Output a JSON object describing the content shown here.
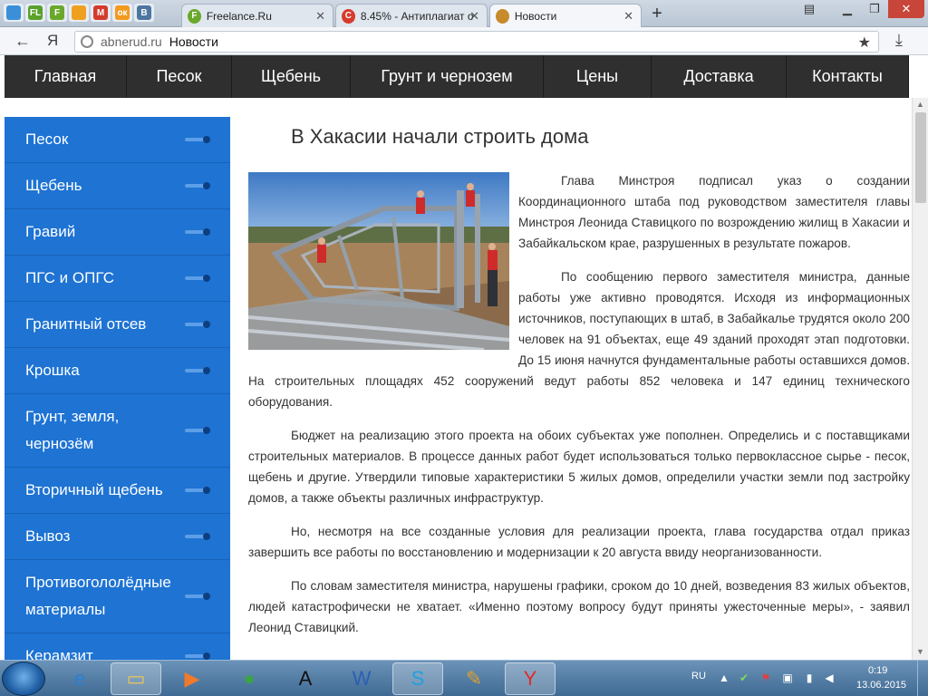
{
  "browser": {
    "pinned_tabs": [
      {
        "icon": "globe-icon",
        "label": "",
        "color": "#3a8fd8"
      },
      {
        "icon": "fl-icon",
        "label": "FL",
        "color": "#5aa12c"
      },
      {
        "icon": "freelance-f-icon",
        "label": "F",
        "color": "#6aa82c"
      },
      {
        "icon": "target-icon",
        "label": "",
        "color": "#f0a020"
      },
      {
        "icon": "gmail-icon",
        "label": "M",
        "color": "#d33b2c"
      },
      {
        "icon": "odnoklassniki-icon",
        "label": "ок",
        "color": "#f39a1d"
      },
      {
        "icon": "vk-icon",
        "label": "В",
        "color": "#4d76a1"
      }
    ],
    "tabs": [
      {
        "title": "Freelance.Ru",
        "icon": "freelance-f-icon",
        "icon_label": "F",
        "color": "#6aa82c",
        "active": false
      },
      {
        "title": "8.45% - Антиплагиат о",
        "icon": "antiplagiat-icon",
        "icon_label": "C",
        "color": "#d83a2c",
        "active": false
      },
      {
        "title": "Новости",
        "icon": "box-icon",
        "icon_label": "",
        "color": "#c88a2a",
        "active": true
      }
    ],
    "url_domain": "abnerud.ru",
    "url_title": "Новости",
    "yandex_label": "Я"
  },
  "site": {
    "topnav": [
      "Главная",
      "Песок",
      "Щебень",
      "Грунт и чернозем",
      "Цены",
      "Доставка",
      "Контакты"
    ],
    "sidebar": [
      "Песок",
      "Щебень",
      "Гравий",
      "ПГС и ОПГС",
      "Гранитный отсев",
      "Крошка",
      "Грунт, земля, чернозём",
      "Вторичный щебень",
      "Вывоз",
      "Противогололёдные материалы",
      "Керамзит"
    ],
    "article": {
      "title": "В Хакасии начали строить дома",
      "paragraphs": [
        "Глава Минстроя подписал указ о создании Координационного штаба под руководством заместителя главы Минстроя Леонида Ставицкого по возрождению жилищ в Хакасии и Забайкальском крае, разрушенных в результате пожаров.",
        "По сообщению первого заместителя министра, данные работы уже активно проводятся. Исходя из информационных источников, поступающих в штаб, в Забайкалье трудятся около 200 человек на 91 объектах, еще 49 зданий проходят этап подготовки. До 15 июня начнутся фундаментальные работы оставшихся домов. На строительных площадях 452 сооружений ведут работы 852 человека и 147 единиц технического оборудования.",
        "Бюджет на реализацию этого проекта на обоих субъектах уже пополнен. Определись и с поставщиками строительных материалов. В процессе данных работ будет использоваться только первоклассное сырье - песок, щебень и другие. Утвердили типовые характеристики 5 жилых домов, определили участки земли под застройку домов, а также объекты различных инфраструктур.",
        "Но, несмотря на все созданные условия для реализации проекта, глава государства отдал приказ завершить все работы по восстановлению и модернизации к 20 августа ввиду неорганизованности.",
        "По словам заместителя министра, нарушены графики, сроком до 10 дней, возведения 83 жилых объектов, людей катастрофически не хватает. «Именно поэтому вопросу будут приняты ужесточенные меры», - заявил Леонид Ставицкий."
      ]
    }
  },
  "taskbar": {
    "apps": [
      {
        "name": "internet-explorer-icon",
        "glyph": "e",
        "color": "#2a7fd4",
        "open": false
      },
      {
        "name": "file-explorer-icon",
        "glyph": "▭",
        "color": "#e9c45a",
        "open": true
      },
      {
        "name": "media-player-icon",
        "glyph": "▶",
        "color": "#f07a2a",
        "open": false
      },
      {
        "name": "chrome-icon",
        "glyph": "●",
        "color": "#3aa345",
        "open": false
      },
      {
        "name": "font-viewer-icon",
        "glyph": "A",
        "color": "#111111",
        "open": false
      },
      {
        "name": "word-icon",
        "glyph": "W",
        "color": "#2b5fb3",
        "open": false
      },
      {
        "name": "skype-icon",
        "glyph": "S",
        "color": "#1fa0e0",
        "open": true
      },
      {
        "name": "paint-icon",
        "glyph": "✎",
        "color": "#e0a030",
        "open": false
      },
      {
        "name": "yandex-browser-icon",
        "glyph": "Y",
        "color": "#e02a2a",
        "open": true
      }
    ],
    "language": "RU",
    "time": "0:19",
    "date": "13.06.2015"
  }
}
